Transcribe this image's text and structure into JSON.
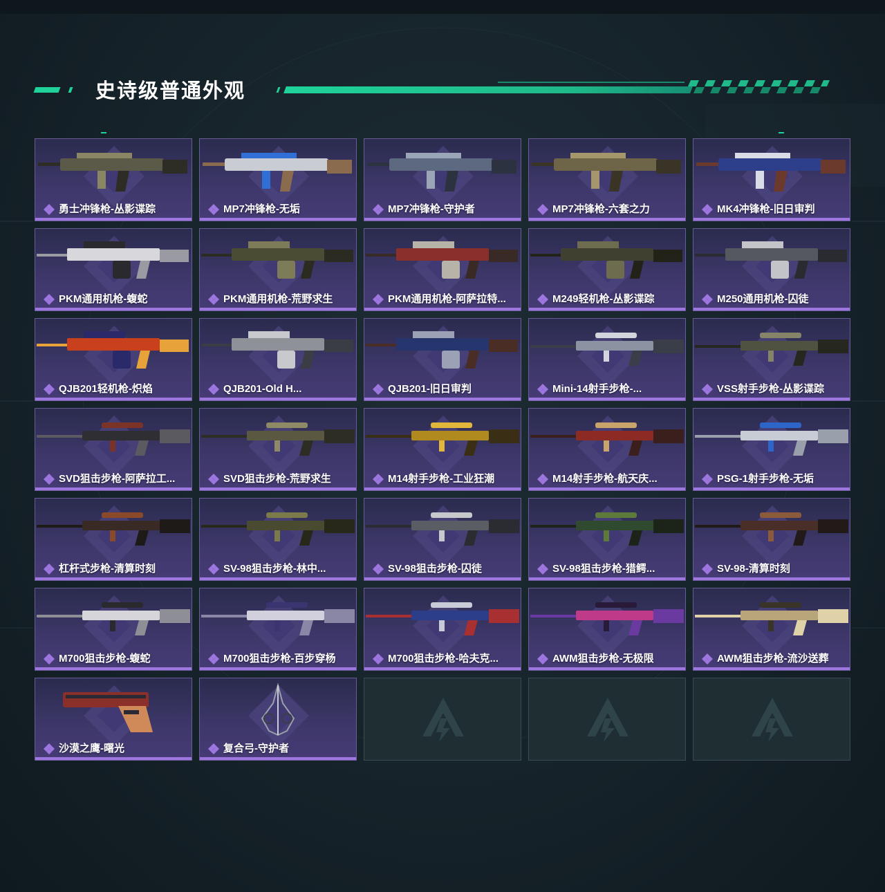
{
  "section_title": "史诗级普通外观",
  "colors": {
    "accent": "#1fd39a",
    "card_bg": "#3e386a",
    "card_border": "#6a5d97",
    "rarity_bar": "#9e76e0",
    "empty_bg": "#1e2e33"
  },
  "rarity_icon": "purple-diamond-cluster-icon",
  "empty_logo_icon": "game-logo-icon",
  "items": [
    {
      "name": "勇士冲锋枪-丛影谍踪",
      "icon": "smg-camo-icon",
      "palette": [
        "#5b5a48",
        "#8a8664",
        "#2e2d25"
      ]
    },
    {
      "name": "MP7冲锋枪-无垢",
      "icon": "smg-white-blue-icon",
      "palette": [
        "#c9ccd2",
        "#2f6fd6",
        "#8a6b4d"
      ]
    },
    {
      "name": "MP7冲锋枪-守护者",
      "icon": "smg-steel-blue-icon",
      "palette": [
        "#5d6980",
        "#9aa5b8",
        "#2c3240"
      ]
    },
    {
      "name": "MP7冲锋枪-六套之力",
      "icon": "smg-desert-icon",
      "palette": [
        "#6e6448",
        "#a6966c",
        "#3a3426"
      ]
    },
    {
      "name": "MK4冲锋枪-旧日审判",
      "icon": "smg-blue-white-icon",
      "palette": [
        "#2d3e8a",
        "#d9dbe6",
        "#6b3a2c"
      ]
    },
    {
      "name": "PKM通用机枪-蝮蛇",
      "icon": "lmg-white-black-icon",
      "palette": [
        "#d8d8dc",
        "#2a2a2e",
        "#9a9aa2"
      ]
    },
    {
      "name": "PKM通用机枪-荒野求生",
      "icon": "lmg-olive-icon",
      "palette": [
        "#4b4c34",
        "#7d7b58",
        "#2b2b22"
      ]
    },
    {
      "name": "PKM通用机枪-阿萨拉特...",
      "icon": "lmg-red-icon",
      "palette": [
        "#8a2f2c",
        "#b8b3a8",
        "#3a2a26"
      ]
    },
    {
      "name": "M249轻机枪-丛影谍踪",
      "icon": "lmg-camo-icon",
      "palette": [
        "#3f402f",
        "#6d6c4f",
        "#222219"
      ]
    },
    {
      "name": "M250通用机枪-囚徒",
      "icon": "lmg-grey-icon",
      "palette": [
        "#55585f",
        "#c2c4c8",
        "#2a2b30"
      ]
    },
    {
      "name": "QJB201轻机枪-炽焰",
      "icon": "lmg-flame-icon",
      "palette": [
        "#c8401c",
        "#2a2a6a",
        "#e7a23a"
      ]
    },
    {
      "name": "QJB201-Old H...",
      "icon": "lmg-silver-icon",
      "palette": [
        "#8e9198",
        "#c7c9cd",
        "#3b3d44"
      ]
    },
    {
      "name": "QJB201-旧日审判",
      "icon": "lmg-navy-icon",
      "palette": [
        "#27356e",
        "#9ba2b6",
        "#4a2e26"
      ]
    },
    {
      "name": "Mini-14射手步枪-...",
      "icon": "rifle-silver-icon",
      "palette": [
        "#8b93a3",
        "#d2d5db",
        "#3a3e48"
      ]
    },
    {
      "name": "VSS射手步枪-丛影谍踪",
      "icon": "rifle-camo-icon",
      "palette": [
        "#4f5240",
        "#858468",
        "#26271f"
      ]
    },
    {
      "name": "SVD狙击步枪-阿萨拉工...",
      "icon": "sniper-wood-icon",
      "palette": [
        "#2f2f33",
        "#7a3326",
        "#5a5a60"
      ]
    },
    {
      "name": "SVD狙击步枪-荒野求生",
      "icon": "sniper-olive-icon",
      "palette": [
        "#5a5840",
        "#8e8a66",
        "#2e2d23"
      ]
    },
    {
      "name": "M14射手步枪-工业狂潮",
      "icon": "rifle-gold-icon",
      "palette": [
        "#b08a1e",
        "#e0b73a",
        "#3a2f14"
      ]
    },
    {
      "name": "M14射手步枪-航天庆...",
      "icon": "rifle-red-icon",
      "palette": [
        "#8c2a24",
        "#c9a46a",
        "#3b1f1c"
      ]
    },
    {
      "name": "PSG-1射手步枪-无垢",
      "icon": "sniper-white-icon",
      "palette": [
        "#c8ccd4",
        "#2d66c8",
        "#9aa0ab"
      ]
    },
    {
      "name": "杠杆式步枪-清算时刻",
      "icon": "lever-rifle-icon",
      "palette": [
        "#3a2a26",
        "#8a4a2a",
        "#1e1a18"
      ]
    },
    {
      "name": "SV-98狙击步枪-林中...",
      "icon": "sniper-forest-icon",
      "palette": [
        "#4a4a30",
        "#7a7a4a",
        "#27271a"
      ]
    },
    {
      "name": "SV-98狙击步枪-囚徒",
      "icon": "sniper-grey-icon",
      "palette": [
        "#5a5d64",
        "#c6c8cc",
        "#2b2c31"
      ]
    },
    {
      "name": "SV-98狙击步枪-猎鳄...",
      "icon": "sniper-green-icon",
      "palette": [
        "#2f4a2e",
        "#5e7a3a",
        "#1c241a"
      ]
    },
    {
      "name": "SV-98-清算时刻",
      "icon": "sniper-brown-icon",
      "palette": [
        "#4a2f28",
        "#8a5a3a",
        "#221a18"
      ]
    },
    {
      "name": "M700狙击步枪-蝮蛇",
      "icon": "sniper-viper-icon",
      "palette": [
        "#d6d6da",
        "#2a2a2e",
        "#8e8e96"
      ]
    },
    {
      "name": "M700狙击步枪-百步穿杨",
      "icon": "sniper-white-purple-icon",
      "palette": [
        "#d2d0dc",
        "#3a3470",
        "#8a86a6"
      ]
    },
    {
      "name": "M700狙击步枪-哈夫克...",
      "icon": "sniper-blue-red-icon",
      "palette": [
        "#2c3e8a",
        "#c8ccd8",
        "#a83030"
      ]
    },
    {
      "name": "AWM狙击步枪-无极限",
      "icon": "sniper-pink-icon",
      "palette": [
        "#c03a8a",
        "#2a1a3a",
        "#6a3aa0"
      ]
    },
    {
      "name": "AWM狙击步枪-流沙送葬",
      "icon": "sniper-sand-icon",
      "palette": [
        "#b8a67a",
        "#3a3428",
        "#e0d2a8"
      ]
    },
    {
      "name": "沙漠之鹰-曙光",
      "icon": "pistol-icon",
      "palette": [
        "#8a2f2a",
        "#2a2a34",
        "#d08a5a"
      ]
    },
    {
      "name": "复合弓-守护者",
      "icon": "compound-bow-icon",
      "palette": [
        "#9aa0aa",
        "#3a3e48",
        "#c8ccd4"
      ]
    }
  ],
  "empty_slots": 3
}
